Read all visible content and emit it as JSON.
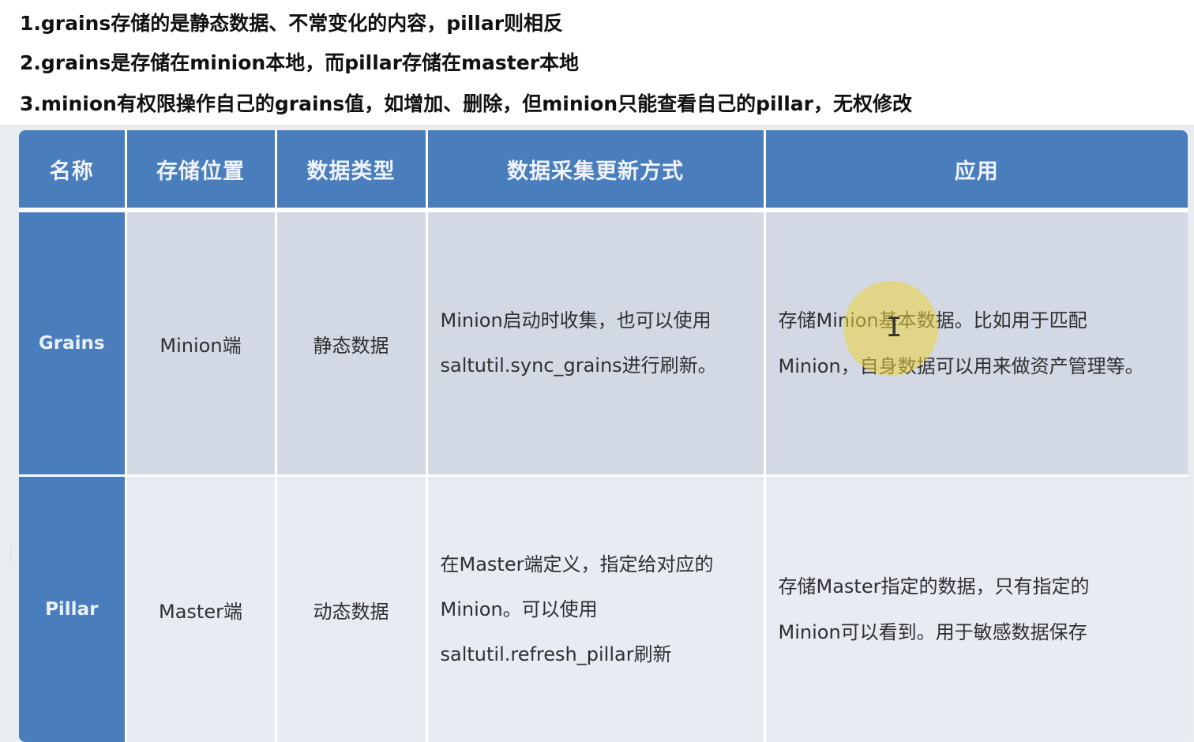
{
  "notes": [
    "1.grains存储的是静态数据、不常变化的内容，pillar则相反",
    "2.grains是存储在minion本地，而pillar存储在master本地",
    "3.minion有权限操作自己的grains值，如增加、删除，但minion只能查看自己的pillar，无权修改"
  ],
  "table": {
    "headers": [
      "名称",
      "存储位置",
      "数据类型",
      "数据采集更新方式",
      "应用"
    ],
    "rows": [
      {
        "name": "Grains",
        "location": "Minion端",
        "data_type": "静态数据",
        "update_lines": [
          "Minion启动时收集，也可以使用",
          "saltutil.sync_grains进行刷新。"
        ],
        "usage_lines": [
          "存储Minion基本数据。比如用于匹配",
          "Minion，自身数据可以用来做资产管理等。"
        ]
      },
      {
        "name": "Pillar",
        "location": "Master端",
        "data_type": "动态数据",
        "update_lines": [
          "在Master端定义，指定给对应的",
          "Minion。可以使用",
          "saltutil.refresh_pillar刷新"
        ],
        "usage_lines": [
          "存储Master指定的数据，只有指定的",
          "Minion可以看到。用于敏感数据保存"
        ]
      }
    ]
  },
  "colors": {
    "header_bg": "#4a7dbc",
    "row_grains_bg": "#d3d8e5",
    "row_pillar_bg": "#e8ebf2",
    "cursor_highlight": "#ecd43c"
  },
  "icons": {
    "cursor": "text-cursor-icon"
  }
}
